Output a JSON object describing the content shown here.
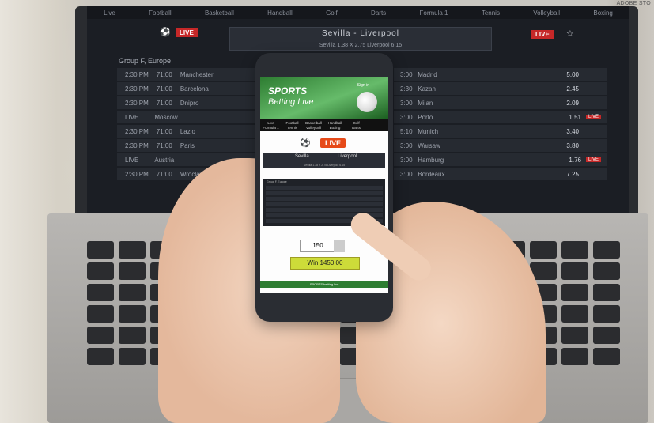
{
  "watermark": "ADOBE STO",
  "laptop": {
    "nav": [
      "Live",
      "Football",
      "Basketball",
      "Handball",
      "Golf",
      "Darts",
      "Formula 1",
      "Tennis",
      "Volleyball",
      "Boxing"
    ],
    "live_label": "LIVE",
    "match": {
      "teams": "Sevilla  -  Liverpool",
      "odds": "Sevilla  1.38     X      2.75   Liverpool  6.15"
    },
    "group_title": "Group F, Europe",
    "left_rows": [
      {
        "time": "2:30 PM",
        "min": "71:00",
        "team": "Manchester"
      },
      {
        "time": "2:30 PM",
        "min": "71:00",
        "team": "Barcelona"
      },
      {
        "time": "2:30 PM",
        "min": "71:00",
        "team": "Dnipro"
      },
      {
        "time": "LIVE",
        "min": "",
        "team": "Moscow"
      },
      {
        "time": "2:30 PM",
        "min": "71:00",
        "team": "Lazio"
      },
      {
        "time": "2:30 PM",
        "min": "71:00",
        "team": "Paris"
      },
      {
        "time": "LIVE",
        "min": "",
        "team": "Austria"
      },
      {
        "time": "2:30 PM",
        "min": "71:00",
        "team": "Wroclaw"
      }
    ],
    "right_rows": [
      {
        "time": "3:00",
        "team": "Madrid",
        "odd": "5.00",
        "live": ""
      },
      {
        "time": "2:30",
        "team": "Kazan",
        "odd": "2.45",
        "live": ""
      },
      {
        "time": "3:00",
        "team": "Milan",
        "odd": "2.09",
        "live": ""
      },
      {
        "time": "3:00",
        "team": "Porto",
        "odd": "1.51",
        "live": "LIVE"
      },
      {
        "time": "5:10",
        "team": "Munich",
        "odd": "3.40",
        "live": ""
      },
      {
        "time": "3:00",
        "team": "Warsaw",
        "odd": "3.80",
        "live": ""
      },
      {
        "time": "3:00",
        "team": "Hamburg",
        "odd": "1.76",
        "live": "LIVE"
      },
      {
        "time": "3:00",
        "team": "Bordeaux",
        "odd": "7.25",
        "live": ""
      }
    ]
  },
  "phone": {
    "banner_title": "SPORTS",
    "banner_subtitle": "Betting Live",
    "signin": "Sign in",
    "sport_nav": [
      "Live",
      "Football",
      "Basketball",
      "Handball",
      "Golf",
      "",
      "Formula 1",
      "Tennis",
      "Volleyball",
      "Boxing",
      "Darts",
      ""
    ],
    "live_label": "LIVE",
    "match_home": "Sevilla",
    "match_away": "Liverpool",
    "match_odds": "Sevilla 1.38    X 2.75    Liverpool 6.15",
    "group_title": "Group F, Europe",
    "stake": "150",
    "win": "Win  1450,00",
    "footer": "SPORTS betting live"
  },
  "colors": {
    "live_red": "#c62828",
    "banner_green": "#2e7d32",
    "win_yellow": "#cddc39"
  }
}
